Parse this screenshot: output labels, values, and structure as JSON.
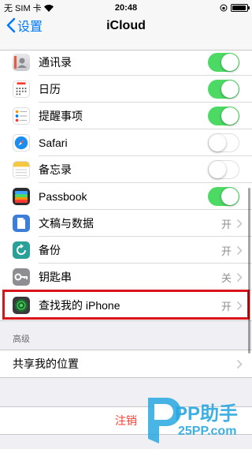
{
  "status": {
    "carrier": "无 SIM 卡",
    "time": "20:48",
    "battery_level": 0.95
  },
  "nav": {
    "back_label": "设置",
    "title": "iCloud"
  },
  "rows": [
    {
      "label": "通讯录",
      "icon": "contacts-icon",
      "control": "toggle",
      "on": true
    },
    {
      "label": "日历",
      "icon": "calendar-icon",
      "control": "toggle",
      "on": true
    },
    {
      "label": "提醒事项",
      "icon": "reminders-icon",
      "control": "toggle",
      "on": true
    },
    {
      "label": "Safari",
      "icon": "safari-icon",
      "control": "toggle",
      "on": false
    },
    {
      "label": "备忘录",
      "icon": "notes-icon",
      "control": "toggle",
      "on": false
    },
    {
      "label": "Passbook",
      "icon": "passbook-icon",
      "control": "toggle",
      "on": true
    },
    {
      "label": "文稿与数据",
      "icon": "documents-icon",
      "control": "disclosure",
      "value": "开"
    },
    {
      "label": "备份",
      "icon": "backup-icon",
      "control": "disclosure",
      "value": "开"
    },
    {
      "label": "钥匙串",
      "icon": "keychain-icon",
      "control": "disclosure",
      "value": "关"
    },
    {
      "label": "查找我的 iPhone",
      "icon": "find-my-iphone-icon",
      "control": "disclosure",
      "value": "开"
    }
  ],
  "advanced": {
    "header": "高级",
    "share_location": "共享我的位置"
  },
  "logout_label": "注销",
  "watermark": {
    "brand": "PP助手",
    "site": "25PP.com"
  },
  "colors": {
    "accent": "#007aff",
    "toggle_on": "#4cd964",
    "highlight": "#d9141b",
    "destructive": "#ff3b30"
  }
}
